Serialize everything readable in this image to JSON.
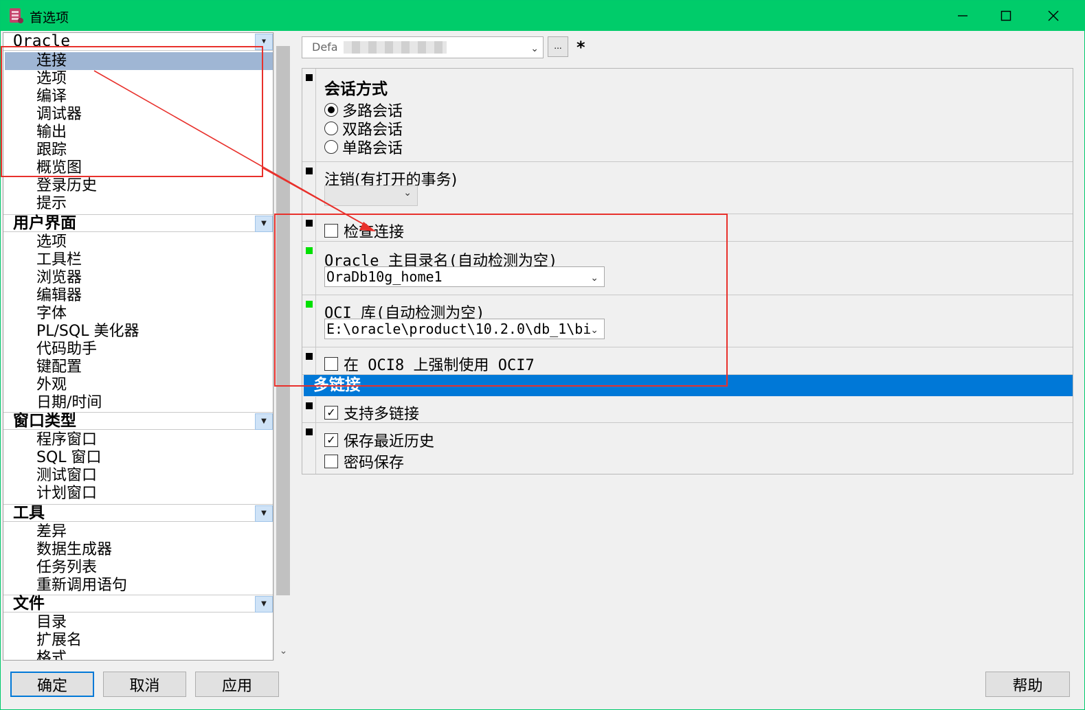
{
  "window": {
    "title": "首选项",
    "minimize": "—",
    "maximize": "☐",
    "close": "✕"
  },
  "tree": {
    "groups": [
      {
        "title": "Oracle",
        "items": [
          "连接",
          "选项",
          "编译",
          "调试器",
          "输出",
          "跟踪",
          "概览图",
          "登录历史",
          "提示"
        ]
      },
      {
        "title": "用户界面",
        "items": [
          "选项",
          "工具栏",
          "浏览器",
          "编辑器",
          "字体",
          "PL/SQL 美化器",
          "代码助手",
          "键配置",
          "外观",
          "日期/时间"
        ]
      },
      {
        "title": "窗口类型",
        "items": [
          "程序窗口",
          "SQL 窗口",
          "测试窗口",
          "计划窗口"
        ]
      },
      {
        "title": "工具",
        "items": [
          "差异",
          "数据生成器",
          "任务列表",
          "重新调用语句"
        ]
      },
      {
        "title": "文件",
        "items": [
          "目录",
          "扩展名",
          "格式"
        ]
      }
    ],
    "selected": "连接"
  },
  "connection": {
    "selector_value": "Defa",
    "ellipsis": "...",
    "modified_marker": "*"
  },
  "settings": {
    "session_mode": {
      "label": "会话方式",
      "options": [
        "多路会话",
        "双路会话",
        "单路会话"
      ],
      "selected": "多路会话"
    },
    "logoff": {
      "label": "注销(有打开的事务)",
      "value": ""
    },
    "check_connection": {
      "label": "检查连接",
      "checked": false
    },
    "oracle_home": {
      "label": "Oracle 主目录名(自动检测为空)",
      "value": "OraDb10g_home1"
    },
    "oci_library": {
      "label": "OCI 库(自动检测为空)",
      "value": "E:\\oracle\\product\\10.2.0\\db_1\\bi"
    },
    "force_oci7": {
      "label": "在 OCI8 上强制使用 OCI7",
      "checked": false
    },
    "multilink": {
      "header": "多链接",
      "support": {
        "label": "支持多链接",
        "checked": true
      },
      "save_history": {
        "label": "保存最近历史",
        "checked": true
      },
      "save_password": {
        "label": "密码保存",
        "checked": false
      }
    }
  },
  "buttons": {
    "ok": "确定",
    "cancel": "取消",
    "apply": "应用",
    "help": "帮助"
  },
  "icons": {
    "app": "preferences-app-icon",
    "dropdown": "chevron-down-icon",
    "group_toggle": "triangle-down-icon"
  },
  "colors": {
    "titlebar": "#00cc6a",
    "selection": "#9fb6d4",
    "section_header": "#0078d7",
    "annotation": "#e8302b",
    "marker_default": "#000000",
    "marker_modified": "#00e000"
  }
}
